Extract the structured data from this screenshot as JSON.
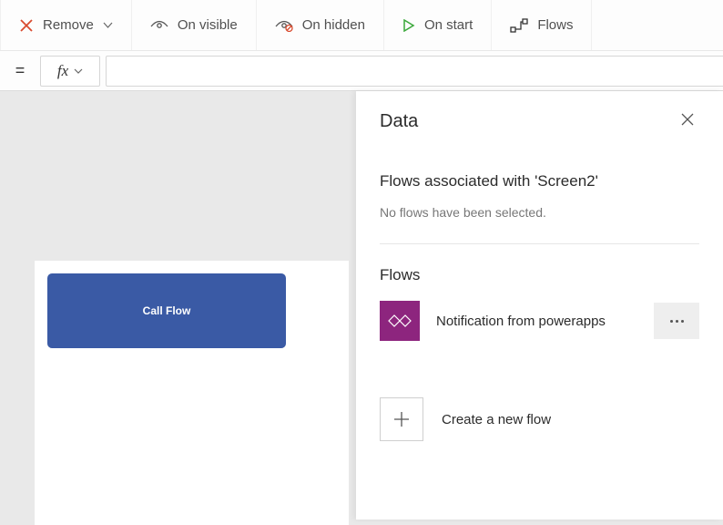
{
  "toolbar": {
    "remove_label": "Remove",
    "on_visible_label": "On visible",
    "on_hidden_label": "On hidden",
    "on_start_label": "On start",
    "flows_label": "Flows"
  },
  "formula": {
    "fx": "fx",
    "value": ""
  },
  "canvas": {
    "button_label": "Call Flow"
  },
  "panel": {
    "title": "Data",
    "associated_title": "Flows associated with 'Screen2'",
    "none_selected": "No flows have been selected.",
    "flows_heading": "Flows",
    "flow_name": "Notification from powerapps",
    "create_label": "Create a new flow"
  }
}
